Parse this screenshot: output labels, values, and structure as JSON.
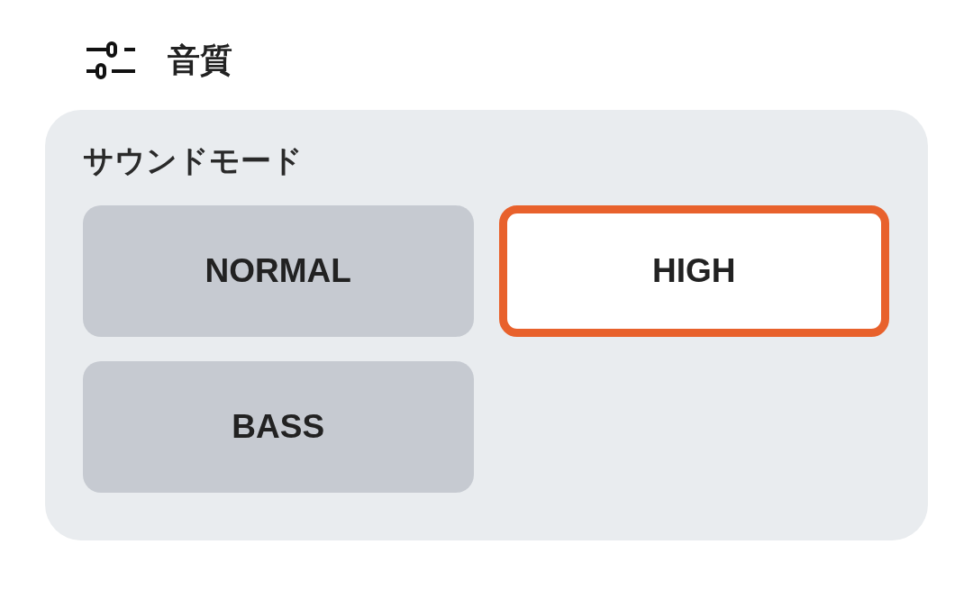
{
  "header": {
    "title": "音質"
  },
  "sound_mode": {
    "label": "サウンドモード",
    "options": [
      {
        "label": "NORMAL",
        "selected": false
      },
      {
        "label": "HIGH",
        "selected": true
      },
      {
        "label": "BASS",
        "selected": false
      }
    ]
  }
}
